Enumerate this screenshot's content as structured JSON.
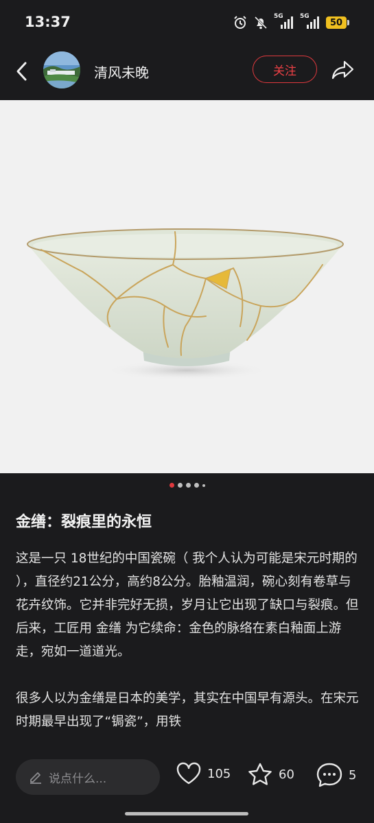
{
  "status": {
    "time": "13:37",
    "signal_label_1": "5G",
    "signal_label_2": "5G",
    "battery": "50"
  },
  "header": {
    "username": "清风未晚",
    "follow_label": "关注"
  },
  "carousel": {
    "total": 5,
    "active_index": 0
  },
  "article": {
    "title": "金缮：裂痕里的永恒",
    "paragraphs": [
      "这是一只 18世纪的中国瓷碗（ 我个人认为可能是宋元时期的 ），直径约21公分，高约8公分。胎釉温润，碗心刻有卷草与花卉纹饰。它并非完好无损，岁月让它出现了缺口与裂痕。但后来，工匠用 金缮 为它续命：金色的脉络在素白釉面上游走，宛如一道道光。",
      "很多人以为金缮是日本的美学，其实在中国早有源头。在宋元时期最早出现了“锔瓷”，用铁"
    ]
  },
  "bottom": {
    "comment_placeholder": "说点什么...",
    "likes": "105",
    "favorites": "60",
    "comments": "5"
  },
  "colors": {
    "accent": "#e0393e",
    "background": "#1b1b1d"
  }
}
